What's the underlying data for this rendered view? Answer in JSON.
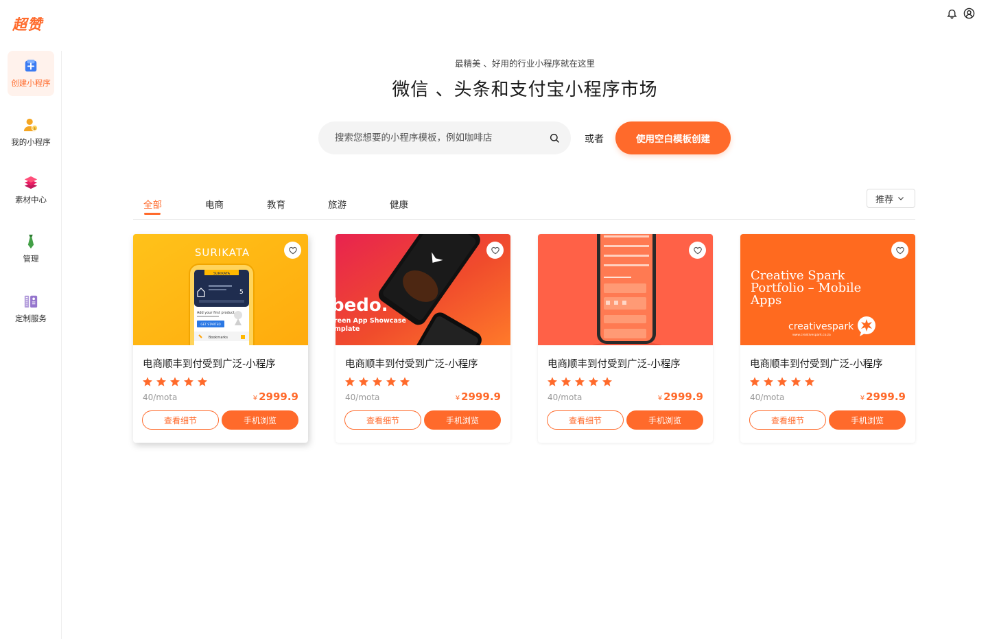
{
  "brand": {
    "logo": "超赞",
    "accent": "#ff6a2b"
  },
  "sidebar": {
    "items": [
      {
        "label": "创建小程序",
        "icon": "plus-square-icon",
        "active": true
      },
      {
        "label": "我的小程序",
        "icon": "user-icon",
        "active": false
      },
      {
        "label": "素材中心",
        "icon": "layers-icon",
        "active": false
      },
      {
        "label": "管理",
        "icon": "tie-icon",
        "active": false
      },
      {
        "label": "定制服务",
        "icon": "tools-icon",
        "active": false
      }
    ]
  },
  "header": {
    "icons": [
      "bell-icon",
      "user-circle-icon"
    ]
  },
  "hero": {
    "subtitle": "最精美 、好用的行业小程序就在这里",
    "title": "微信 、头条和支付宝小程序市场"
  },
  "search": {
    "placeholder": "搜索您想要的小程序模板，例如咖啡店",
    "value": "",
    "or_text": "或者",
    "blank_button": "使用空白模板创建"
  },
  "tabs": [
    {
      "label": "全部",
      "active": true
    },
    {
      "label": "电商",
      "active": false
    },
    {
      "label": "教育",
      "active": false
    },
    {
      "label": "旅游",
      "active": false
    },
    {
      "label": "健康",
      "active": false
    }
  ],
  "sort": {
    "selected": "推荐"
  },
  "cards": [
    {
      "title": "电商顺丰到付受到广泛-小程序",
      "rating": 5,
      "unit": "40/mota",
      "currency": "¥",
      "price": "2999.9",
      "detail_button": "查看细节",
      "preview_button": "手机浏览",
      "thumb": {
        "brand": "SURIKATA",
        "caption": "Add your first product",
        "cta": "GET STARTED",
        "row": "Bookmarks",
        "badge": "5"
      }
    },
    {
      "title": "电商顺丰到付受到广泛-小程序",
      "rating": 5,
      "unit": "40/mota",
      "currency": "¥",
      "price": "2999.9",
      "detail_button": "查看细节",
      "preview_button": "手机浏览",
      "thumb": {
        "brand": "bedo.",
        "line1": "reen App Showcase",
        "line2": "mplate"
      }
    },
    {
      "title": "电商顺丰到付受到广泛-小程序",
      "rating": 5,
      "unit": "40/mota",
      "currency": "¥",
      "price": "2999.9",
      "detail_button": "查看细节",
      "preview_button": "手机浏览",
      "thumb": {}
    },
    {
      "title": "电商顺丰到付受到广泛-小程序",
      "rating": 5,
      "unit": "40/mota",
      "currency": "¥",
      "price": "2999.9",
      "detail_button": "查看细节",
      "preview_button": "手机浏览",
      "thumb": {
        "line1": "Creative Spark",
        "line2": "Portfolio – Mobile",
        "line3": "Apps",
        "brand": "creativespark",
        "url": "www.creativespark.co.za"
      }
    }
  ]
}
